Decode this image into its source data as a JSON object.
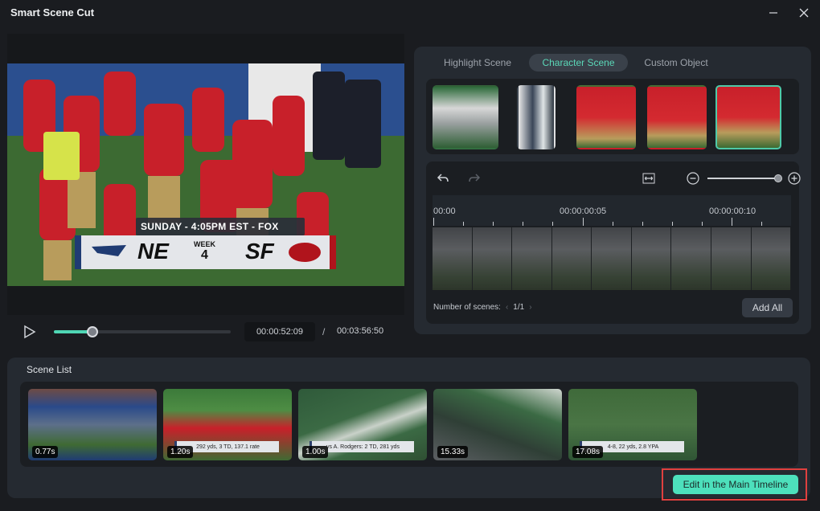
{
  "window": {
    "title": "Smart Scene Cut",
    "minimize_icon": "minimize-icon",
    "close_icon": "close-icon"
  },
  "preview": {
    "scoreboard": {
      "banner": "SUNDAY - 4:05PM EST - FOX",
      "team_left": "NE",
      "week_label": "WEEK",
      "week_number": "4",
      "team_right": "SF"
    },
    "player": {
      "play_icon": "play-icon",
      "progress": 0.22,
      "current_time": "00:00:52:09",
      "separator": "/",
      "total_time": "00:03:56:50"
    }
  },
  "detection": {
    "tabs": [
      {
        "label": "Highlight Scene",
        "active": false
      },
      {
        "label": "Character Scene",
        "active": true
      },
      {
        "label": "Custom Object",
        "active": false
      }
    ],
    "character_thumbnails": [
      {
        "name": "character-1",
        "selected": false
      },
      {
        "name": "character-2",
        "selected": false
      },
      {
        "name": "character-3",
        "selected": false
      },
      {
        "name": "character-4",
        "selected": false
      },
      {
        "name": "character-5",
        "selected": true
      }
    ],
    "timeline": {
      "undo_icon": "undo-icon",
      "redo_icon": "redo-icon",
      "fit_icon": "fit-to-width-icon",
      "zoom_out_icon": "zoom-out-icon",
      "zoom_in_icon": "zoom-in-icon",
      "zoom_level": 1.0,
      "ruler_labels": [
        ":00:00",
        "00:00:00:05",
        "00:00:00:10"
      ]
    },
    "scenes_count_label": "Number of scenes:",
    "scenes_count_value": "1/1",
    "add_all_label": "Add All"
  },
  "scene_list": {
    "title": "Scene List",
    "scenes": [
      {
        "duration": "0.77s",
        "caption": ""
      },
      {
        "duration": "1.20s",
        "caption": "292 yds, 3 TD, 137.1 rate"
      },
      {
        "duration": "1.00s",
        "caption": "vs A. Rodgers: 2 TD, 281 yds"
      },
      {
        "duration": "15.33s",
        "caption": ""
      },
      {
        "duration": "17.08s",
        "caption": "4-8, 22 yds, 2.8 YPA"
      }
    ],
    "edit_button_label": "Edit in the Main Timeline"
  },
  "colors": {
    "accent": "#4de0bc",
    "active_tab_text": "#5bd8b8",
    "highlight_border": "#e0403f",
    "background": "#1a1c20",
    "panel": "#252a31"
  }
}
